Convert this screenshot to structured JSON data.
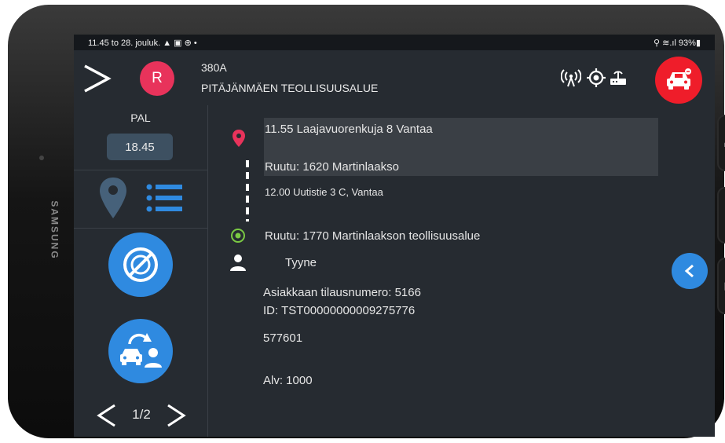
{
  "device": {
    "brand": "SAMSUNG"
  },
  "statusbar": {
    "time_date": "11.45  to 28. jouluk.",
    "left_icons": "▲ ▣ ⊕ •",
    "right": "⚲ ≋.ıl 93%▮"
  },
  "header": {
    "avatar_letter": "R",
    "route_code": "380A",
    "route_name": "PITÄJÄNMÄEN TEOLLISUUSALUE"
  },
  "sidebar": {
    "label": "PAL",
    "time": "18.45",
    "page": "1/2"
  },
  "trip": {
    "pickup": "11.55 Laajavuorenkuja 8 Vantaa",
    "pickup_area": "Ruutu: 1620 Martinlaakso",
    "stop": "12.00 Uutistie 3 C, Vantaa",
    "dropoff_area": "Ruutu: 1770 Martinlaakson teollisuusalue",
    "passenger": "Tyyne",
    "order_number": "Asiakkaan tilausnumero: 5166",
    "id": "ID: TST00000000009275776",
    "code": "577601",
    "alv": "Alv: 1000"
  },
  "icons": {
    "menu": "chevron-right-icon",
    "signal": "antenna-icon",
    "gps": "gps-target-icon",
    "router": "router-icon",
    "car": "car-icon",
    "pin": "map-pin-icon",
    "list": "list-icon",
    "no_meter": "no-meter-icon",
    "swap": "swap-passenger-icon",
    "person": "person-icon",
    "back": "chevron-left-icon"
  },
  "colors": {
    "accent": "#2f8ae0",
    "alert": "#ef1d2a",
    "avatar": "#e8335b",
    "pickup_pin": "#e8335b",
    "dropoff": "#7ac943"
  }
}
